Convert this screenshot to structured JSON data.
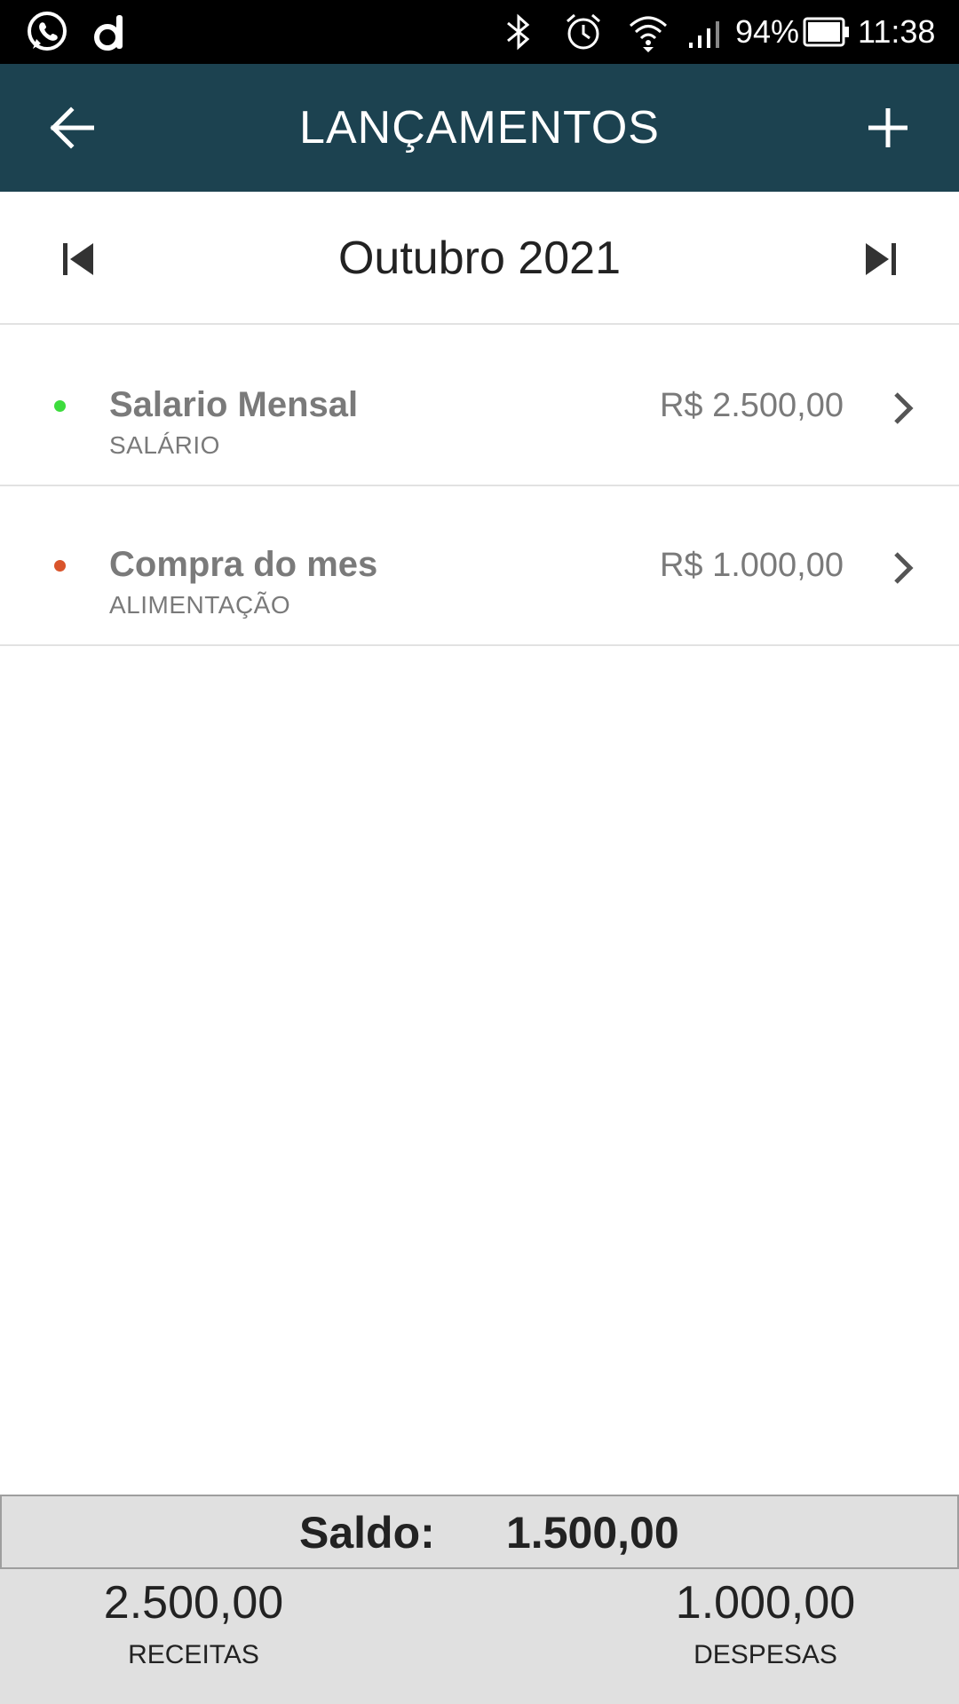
{
  "status_bar": {
    "battery": "94%",
    "time": "11:38",
    "icons": [
      "whatsapp-icon",
      "app-d-icon",
      "bluetooth-icon",
      "alarm-icon",
      "wifi-icon",
      "signal-icon",
      "battery-icon"
    ]
  },
  "app_bar": {
    "title": "LANÇAMENTOS",
    "background": "#1c4250"
  },
  "month_selector": {
    "label": "Outubro 2021"
  },
  "entries": [
    {
      "name": "Salario Mensal",
      "category": "SALÁRIO",
      "amount": "R$ 2.500,00",
      "dot_color": "#3ddc3d"
    },
    {
      "name": "Compra do mes",
      "category": "ALIMENTAÇÃO",
      "amount": "R$ 1.000,00",
      "dot_color": "#d9542b"
    }
  ],
  "footer": {
    "saldo_label": "Saldo:",
    "saldo_value": "1.500,00",
    "receitas_value": "2.500,00",
    "receitas_label": "RECEITAS",
    "despesas_value": "1.000,00",
    "despesas_label": "DESPESAS"
  }
}
